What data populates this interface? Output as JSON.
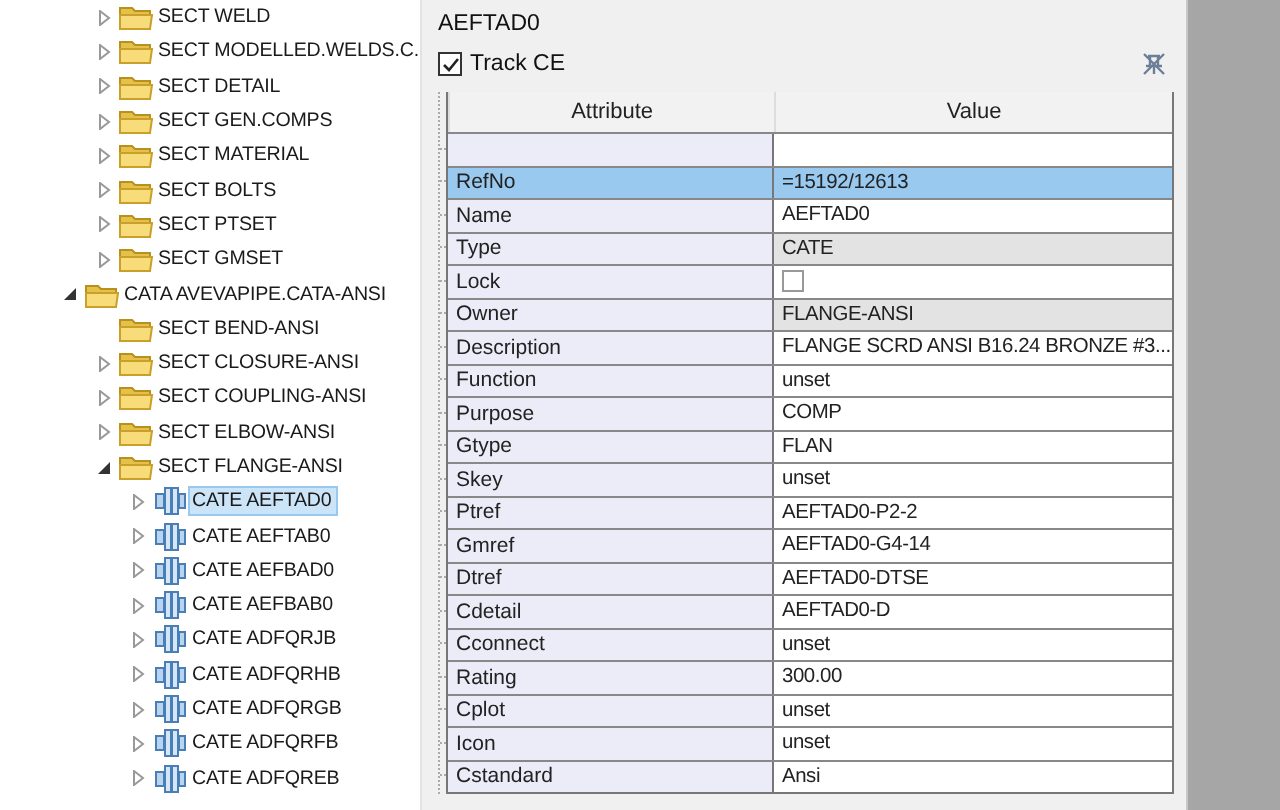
{
  "tree": {
    "items_above": [
      {
        "label": "SECT WELD",
        "kind": "sect",
        "expanded": false,
        "selected": false
      },
      {
        "label": "SECT MODELLED.WELDS.C.",
        "kind": "sect",
        "expanded": false,
        "selected": false
      },
      {
        "label": "SECT DETAIL",
        "kind": "sect",
        "expanded": false,
        "selected": false
      },
      {
        "label": "SECT GEN.COMPS",
        "kind": "sect",
        "expanded": false,
        "selected": false
      },
      {
        "label": "SECT MATERIAL",
        "kind": "sect",
        "expanded": false,
        "selected": false
      },
      {
        "label": "SECT BOLTS",
        "kind": "sect",
        "expanded": false,
        "selected": false
      },
      {
        "label": "SECT PTSET",
        "kind": "sect",
        "expanded": false,
        "selected": false
      },
      {
        "label": "SECT GMSET",
        "kind": "sect",
        "expanded": false,
        "selected": false
      }
    ],
    "nodes": [
      {
        "label": "CATA AVEVAPIPE.CATA-ANSI",
        "kind": "cata",
        "expanded": true,
        "selected": false,
        "children": [
          {
            "label": "SECT BEND-ANSI",
            "kind": "sect",
            "leaf": true,
            "selected": false
          },
          {
            "label": "SECT CLOSURE-ANSI",
            "kind": "sect",
            "expanded": false,
            "selected": false
          },
          {
            "label": "SECT COUPLING-ANSI",
            "kind": "sect",
            "expanded": false,
            "selected": false
          },
          {
            "label": "SECT ELBOW-ANSI",
            "kind": "sect",
            "expanded": false,
            "selected": false
          },
          {
            "label": "SECT FLANGE-ANSI",
            "kind": "sect",
            "expanded": true,
            "selected": false,
            "children": [
              {
                "label": "CATE AEFTAD0",
                "kind": "cate",
                "expanded": false,
                "selected": true
              },
              {
                "label": "CATE AEFTAB0",
                "kind": "cate",
                "expanded": false,
                "selected": false
              },
              {
                "label": "CATE AEFBAD0",
                "kind": "cate",
                "expanded": false,
                "selected": false
              },
              {
                "label": "CATE AEFBAB0",
                "kind": "cate",
                "expanded": false,
                "selected": false
              },
              {
                "label": "CATE ADFQRJB",
                "kind": "cate",
                "expanded": false,
                "selected": false
              },
              {
                "label": "CATE ADFQRHB",
                "kind": "cate",
                "expanded": false,
                "selected": false
              },
              {
                "label": "CATE ADFQRGB",
                "kind": "cate",
                "expanded": false,
                "selected": false
              },
              {
                "label": "CATE ADFQRFB",
                "kind": "cate",
                "expanded": false,
                "selected": false
              },
              {
                "label": "CATE ADFQREB",
                "kind": "cate",
                "expanded": false,
                "selected": false
              }
            ]
          }
        ]
      }
    ]
  },
  "panel": {
    "title": "AEFTAD0",
    "track_ce": {
      "label": "Track CE",
      "checked": true
    },
    "table": {
      "columns": [
        "Attribute",
        "Value"
      ],
      "rows": [
        {
          "attribute": "",
          "value": "",
          "kind": "text",
          "selected": false
        },
        {
          "attribute": "RefNo",
          "value": "=15192/12613",
          "kind": "text",
          "selected": true
        },
        {
          "attribute": "Name",
          "value": "AEFTAD0",
          "kind": "text",
          "selected": false
        },
        {
          "attribute": "Type",
          "value": "CATE",
          "kind": "text",
          "selected": false,
          "readonly": true
        },
        {
          "attribute": "Lock",
          "kind": "checkbox",
          "checked": false,
          "selected": false
        },
        {
          "attribute": "Owner",
          "value": "FLANGE-ANSI",
          "kind": "text",
          "selected": false,
          "readonly": true
        },
        {
          "attribute": "Description",
          "value": "FLANGE SCRD ANSI B16.24 BRONZE #3...",
          "kind": "text",
          "selected": false
        },
        {
          "attribute": "Function",
          "value": "unset",
          "kind": "text",
          "selected": false
        },
        {
          "attribute": "Purpose",
          "value": "COMP",
          "kind": "text",
          "selected": false
        },
        {
          "attribute": "Gtype",
          "value": "FLAN",
          "kind": "text",
          "selected": false
        },
        {
          "attribute": "Skey",
          "value": "unset",
          "kind": "text",
          "selected": false
        },
        {
          "attribute": "Ptref",
          "value": "AEFTAD0-P2-2",
          "kind": "text",
          "selected": false
        },
        {
          "attribute": "Gmref",
          "value": "AEFTAD0-G4-14",
          "kind": "text",
          "selected": false
        },
        {
          "attribute": "Dtref",
          "value": "AEFTAD0-DTSE",
          "kind": "text",
          "selected": false
        },
        {
          "attribute": "Cdetail",
          "value": "AEFTAD0-D",
          "kind": "text",
          "selected": false
        },
        {
          "attribute": "Cconnect",
          "value": "unset",
          "kind": "text",
          "selected": false
        },
        {
          "attribute": "Rating",
          "value": "300.00",
          "kind": "text",
          "selected": false
        },
        {
          "attribute": "Cplot",
          "value": "unset",
          "kind": "text",
          "selected": false
        },
        {
          "attribute": "Icon",
          "value": "unset",
          "kind": "text",
          "selected": false
        },
        {
          "attribute": "Cstandard",
          "value": "Ansi",
          "kind": "text",
          "selected": false
        }
      ]
    }
  }
}
